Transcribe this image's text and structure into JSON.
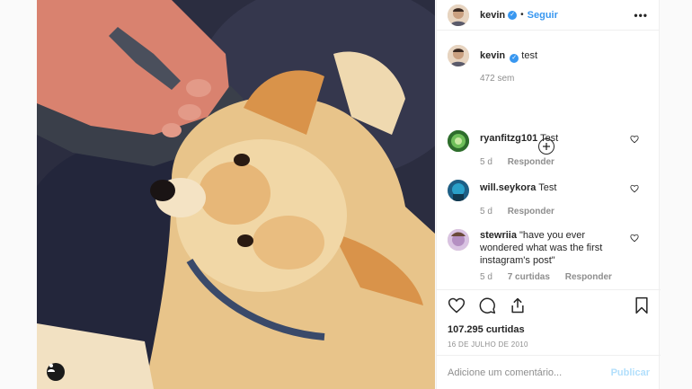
{
  "post": {
    "author": "kevin",
    "follow_label": "Seguir",
    "more_label": "•••",
    "separator": "•"
  },
  "caption": {
    "author": "kevin",
    "text": "test",
    "age": "472 sem"
  },
  "comments": [
    {
      "user": "ryanfitzg101",
      "text": "Test",
      "age": "5 d",
      "likes": "",
      "reply": "Responder",
      "avatar_color": "#3d8b3a"
    },
    {
      "user": "will.seykora",
      "text": "Test",
      "age": "5 d",
      "likes": "",
      "reply": "Responder",
      "avatar_color": "#2f6f8f"
    },
    {
      "user": "stewriia",
      "text": "\"have you ever wondered what was the first instagram's post\"",
      "age": "5 d",
      "likes": "7 curtidas",
      "reply": "Responder",
      "avatar_color": "#b48fc2"
    }
  ],
  "stats": {
    "likes": "107.295 curtidas",
    "date": "16 DE JULHO DE 2010"
  },
  "composer": {
    "placeholder": "Adicione um comentário...",
    "publish_label": "Publicar"
  },
  "colors": {
    "accent": "#3897f0",
    "publish_disabled": "#b2dffc",
    "verified": "#3897f0"
  },
  "icons": [
    "heart-icon",
    "comment-icon",
    "share-icon",
    "bookmark-icon",
    "plus-circle-icon",
    "verified-badge-icon",
    "user-tag-icon"
  ]
}
